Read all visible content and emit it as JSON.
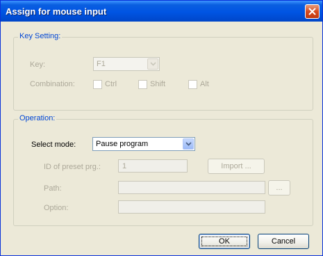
{
  "window": {
    "title": "Assign for mouse input"
  },
  "key_setting": {
    "legend": "Key Setting:",
    "key_label": "Key:",
    "key_value": "F1",
    "combination_label": "Combination:",
    "ctrl_label": "Ctrl",
    "shift_label": "Shift",
    "alt_label": "Alt"
  },
  "operation": {
    "legend": "Operation:",
    "select_mode_label": "Select mode:",
    "select_mode_value": "Pause program",
    "preset_label": "ID of preset prg.:",
    "preset_value": "1",
    "import_label": "Import ...",
    "path_label": "Path:",
    "path_value": "",
    "browse_label": "...",
    "option_label": "Option:",
    "option_value": ""
  },
  "buttons": {
    "ok": "OK",
    "cancel": "Cancel"
  }
}
